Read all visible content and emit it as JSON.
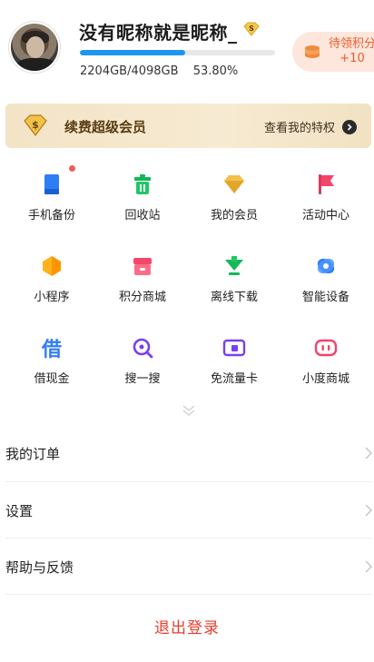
{
  "profile": {
    "nickname": "没有昵称就是昵称_",
    "storage_used": "2204GB/4098GB",
    "storage_percent": "53.80%",
    "storage_fraction": 0.538,
    "avatar_icon": "avatar-photo"
  },
  "points": {
    "title": "待领积分",
    "value": "+10",
    "icon": "coin-stack-icon",
    "color": "#f05a28"
  },
  "vip_banner": {
    "label": "续费超级会员",
    "action": "查看我的特权",
    "icon": "vip-diamond-icon"
  },
  "grid": [
    {
      "label": "手机备份",
      "icon": "phone-backup-icon",
      "badge": true
    },
    {
      "label": "回收站",
      "icon": "trash-icon"
    },
    {
      "label": "我的会员",
      "icon": "diamond-icon"
    },
    {
      "label": "活动中心",
      "icon": "flag-icon"
    },
    {
      "label": "小程序",
      "icon": "mini-program-icon"
    },
    {
      "label": "积分商城",
      "icon": "store-icon"
    },
    {
      "label": "离线下载",
      "icon": "download-icon"
    },
    {
      "label": "智能设备",
      "icon": "smart-device-icon"
    },
    {
      "label": "借现金",
      "icon": "borrow-cash-icon"
    },
    {
      "label": "搜一搜",
      "icon": "search-icon"
    },
    {
      "label": "免流量卡",
      "icon": "data-card-icon"
    },
    {
      "label": "小度商城",
      "icon": "xiaodu-store-icon"
    }
  ],
  "list": [
    {
      "label": "我的订单"
    },
    {
      "label": "设置"
    },
    {
      "label": "帮助与反馈"
    }
  ],
  "logout": "退出登录",
  "colors": {
    "accent_blue": "#1e96f0",
    "logout_red": "#e83d2a",
    "vip_gold": "#f3e4c7"
  }
}
